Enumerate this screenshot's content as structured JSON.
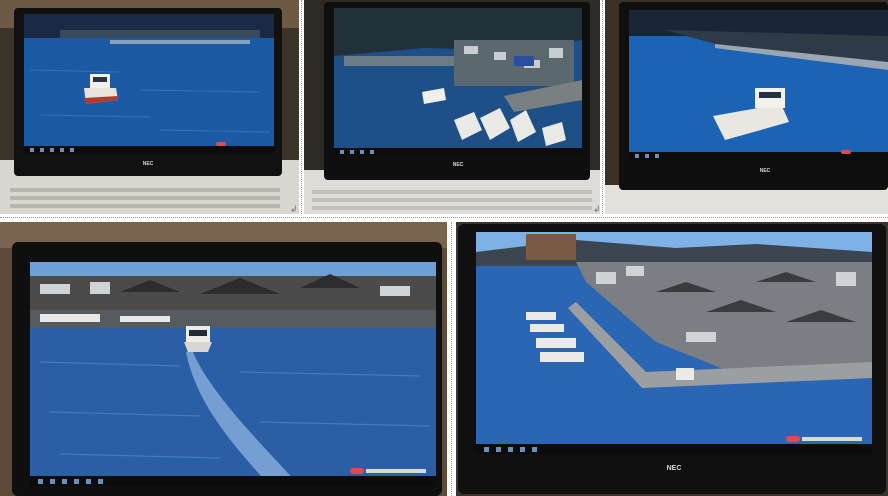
{
  "photos": [
    {
      "id": "photo-1",
      "brand": "NEC"
    },
    {
      "id": "photo-2",
      "brand": "NEC"
    },
    {
      "id": "photo-3",
      "brand": "NEC"
    },
    {
      "id": "photo-4",
      "brand": ""
    },
    {
      "id": "photo-5",
      "brand": "NEC"
    }
  ],
  "paragraph_mark": "↲"
}
